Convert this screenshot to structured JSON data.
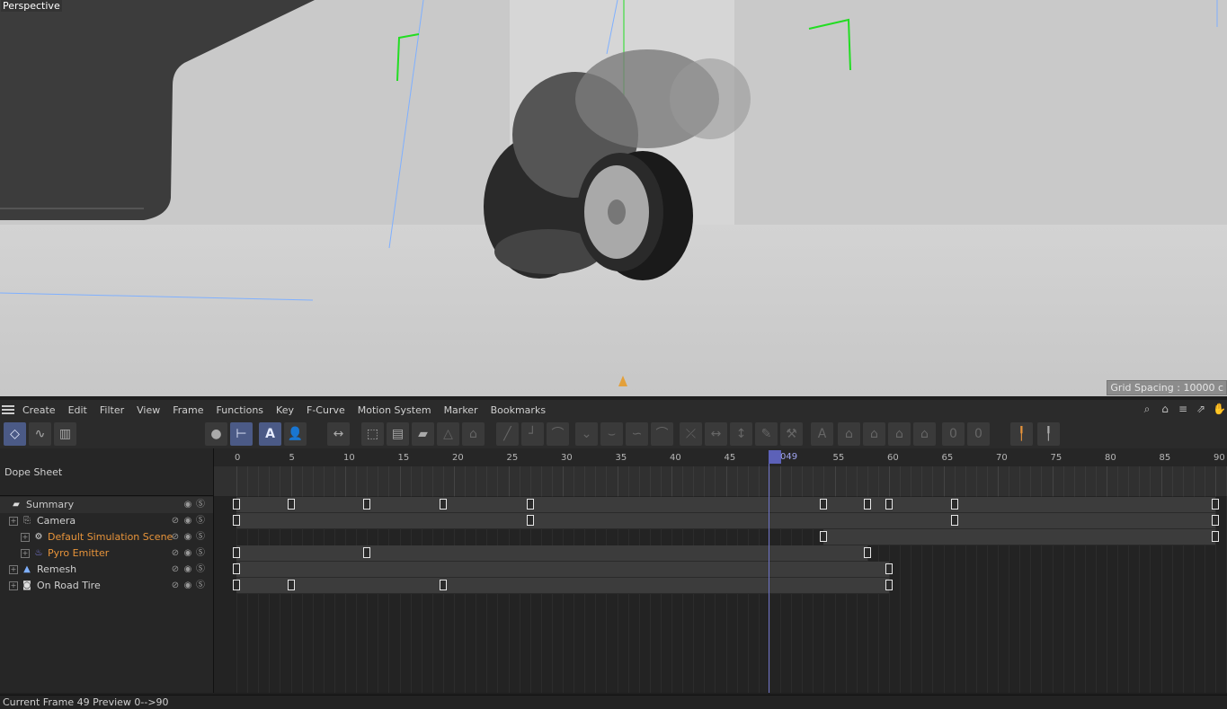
{
  "viewport": {
    "label": "Perspective",
    "grid_spacing": "Grid Spacing : 10000 c"
  },
  "menubar": {
    "items": [
      "Create",
      "Edit",
      "Filter",
      "View",
      "Frame",
      "Functions",
      "Key",
      "F-Curve",
      "Motion System",
      "Marker",
      "Bookmarks"
    ],
    "right_icons": [
      "search-icon",
      "home-icon",
      "filter-icon",
      "external-icon",
      "hand-icon"
    ]
  },
  "dope_sheet": {
    "title": "Dope Sheet",
    "ruler_ticks": [
      "0",
      "5",
      "10",
      "15",
      "20",
      "25",
      "30",
      "35",
      "40",
      "45",
      "50",
      "55",
      "60",
      "65",
      "70",
      "75",
      "80",
      "85",
      "90"
    ],
    "current_frame_label": "049",
    "rows": [
      {
        "name": "Summary",
        "color": "#cfcfcf",
        "icon": "folder-icon",
        "keys": [
          0,
          5,
          12,
          19,
          27,
          54,
          58,
          60,
          66,
          90
        ]
      },
      {
        "name": "Camera",
        "color": "#cfcfcf",
        "icon": "camera-icon",
        "keys": [
          0,
          27,
          66,
          90
        ]
      },
      {
        "name": "Default Simulation Scene",
        "color": "#e8943a",
        "icon": "gear-icon",
        "keys": [
          54,
          90
        ]
      },
      {
        "name": "Pyro Emitter",
        "color": "#e8943a",
        "icon": "flame-icon",
        "keys": [
          0,
          12,
          58
        ]
      },
      {
        "name": "Remesh",
        "color": "#cfcfcf",
        "icon": "remesh-icon",
        "keys": [
          0,
          60
        ]
      },
      {
        "name": "On Road Tire",
        "color": "#cfcfcf",
        "icon": "object-icon",
        "keys": [
          0,
          5,
          19,
          60
        ]
      }
    ]
  },
  "status": {
    "text": "Current Frame  49  Preview  0-->90"
  }
}
